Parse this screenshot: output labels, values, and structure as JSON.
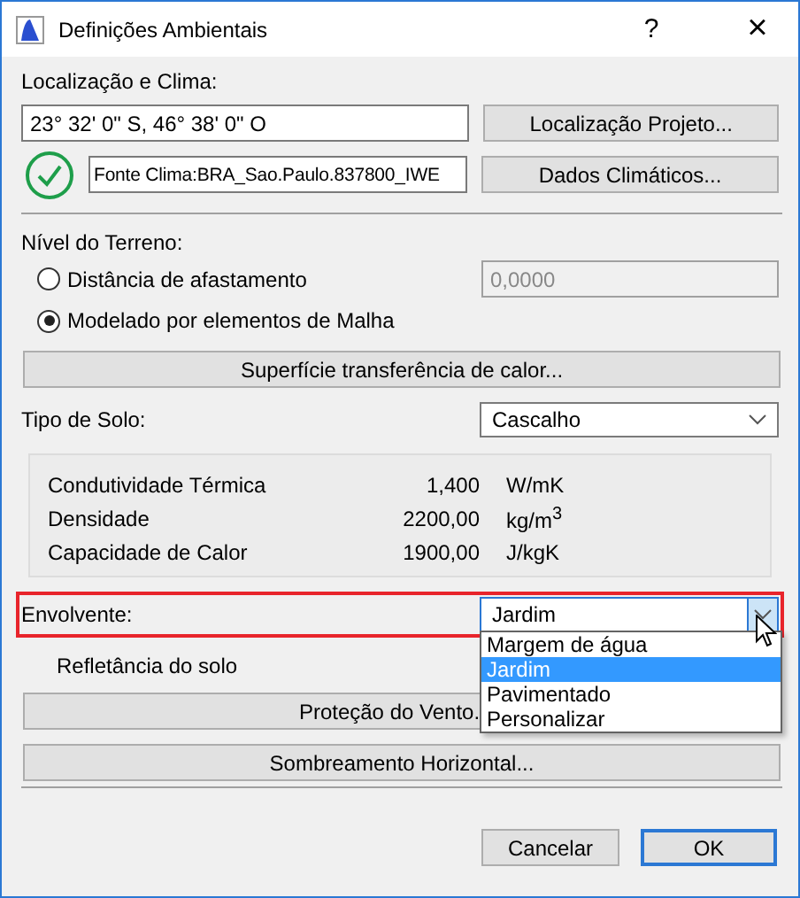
{
  "window": {
    "title": "Definições Ambientais",
    "help": "?",
    "close": "×"
  },
  "location": {
    "label": "Localização e Clima:",
    "coordinates": "23° 32' 0\" S, 46° 38' 0\" O",
    "location_button": "Localização Projeto...",
    "climate_ok": true,
    "climate_source": "Fonte Clima:BRA_Sao.Paulo.837800_IWE",
    "climate_button": "Dados Climáticos..."
  },
  "terrain": {
    "label": "Nível do Terreno:",
    "options": [
      {
        "label": "Distância de afastamento",
        "selected": false
      },
      {
        "label": "Modelado por elementos de Malha",
        "selected": true
      }
    ],
    "distance": {
      "value": "0,0000",
      "disabled": true
    },
    "surface_button": "Superfície transferência de calor..."
  },
  "soil": {
    "label": "Tipo de Solo:",
    "value": "Cascalho",
    "properties": [
      {
        "name": "Condutividade Térmica",
        "value": "1,400",
        "unit": "W/mK"
      },
      {
        "name": "Densidade",
        "value": "2200,00",
        "unit": "kg/m$^{3}$"
      },
      {
        "name": "Capacidade de Calor",
        "value": "1900,00",
        "unit": "J/kgK"
      }
    ]
  },
  "surroundings": {
    "label": "Envolvente:",
    "value": "Jardim",
    "highlighted": true,
    "expanded": true,
    "options": [
      {
        "label": "Margem de água",
        "selected": false
      },
      {
        "label": "Jardim",
        "selected": true
      },
      {
        "label": "Pavimentado",
        "selected": false
      },
      {
        "label": "Personalizar",
        "selected": false
      }
    ]
  },
  "reflectance_label": "Refletância do solo",
  "wind_button": "Proteção do Vento.",
  "shading_button": "Sombreamento Horizontal...",
  "buttons": [
    {
      "label": "Cancelar",
      "default": false
    },
    {
      "label": "OK",
      "default": true
    }
  ]
}
